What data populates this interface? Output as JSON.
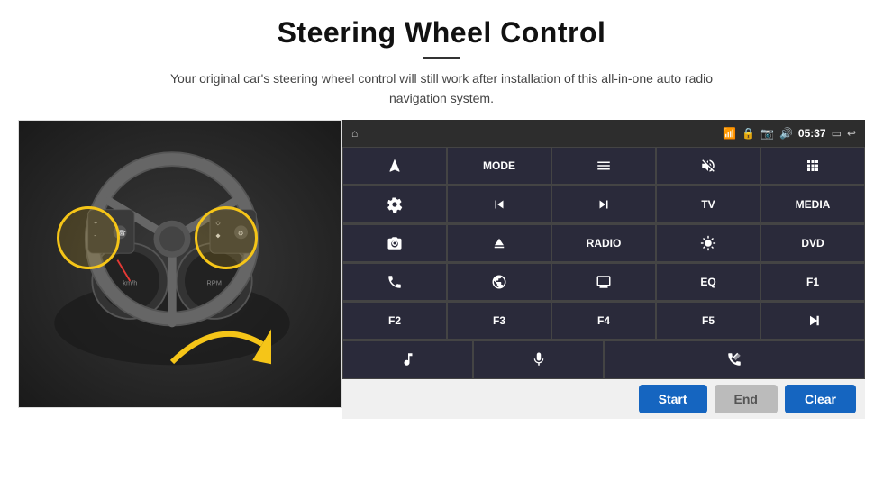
{
  "header": {
    "title": "Steering Wheel Control",
    "description": "Your original car's steering wheel control will still work after installation of this all-in-one auto radio navigation system."
  },
  "status_bar": {
    "time": "05:37",
    "icons": [
      "home",
      "wifi",
      "lock",
      "sd",
      "bluetooth",
      "battery",
      "screen",
      "back"
    ]
  },
  "button_grid": {
    "rows": [
      [
        {
          "type": "icon",
          "icon": "navigate",
          "label": "navigate"
        },
        {
          "type": "text",
          "label": "MODE"
        },
        {
          "type": "icon",
          "icon": "list",
          "label": "list"
        },
        {
          "type": "icon",
          "icon": "mute",
          "label": "mute"
        },
        {
          "type": "icon",
          "icon": "apps",
          "label": "apps"
        }
      ],
      [
        {
          "type": "icon",
          "icon": "settings",
          "label": "settings"
        },
        {
          "type": "icon",
          "icon": "prev",
          "label": "prev"
        },
        {
          "type": "icon",
          "icon": "next",
          "label": "next"
        },
        {
          "type": "text",
          "label": "TV"
        },
        {
          "type": "text",
          "label": "MEDIA"
        }
      ],
      [
        {
          "type": "icon",
          "icon": "360-cam",
          "label": "360"
        },
        {
          "type": "icon",
          "icon": "eject",
          "label": "eject"
        },
        {
          "type": "text",
          "label": "RADIO"
        },
        {
          "type": "icon",
          "icon": "brightness",
          "label": "brightness"
        },
        {
          "type": "text",
          "label": "DVD"
        }
      ],
      [
        {
          "type": "icon",
          "icon": "phone",
          "label": "phone"
        },
        {
          "type": "icon",
          "icon": "browse",
          "label": "browse"
        },
        {
          "type": "icon",
          "icon": "screen-mirror",
          "label": "screen"
        },
        {
          "type": "text",
          "label": "EQ"
        },
        {
          "type": "text",
          "label": "F1"
        }
      ],
      [
        {
          "type": "text",
          "label": "F2"
        },
        {
          "type": "text",
          "label": "F3"
        },
        {
          "type": "text",
          "label": "F4"
        },
        {
          "type": "text",
          "label": "F5"
        },
        {
          "type": "icon",
          "icon": "play-pause",
          "label": "play-pause"
        }
      ],
      [
        {
          "type": "icon",
          "icon": "music",
          "label": "music"
        },
        {
          "type": "icon",
          "icon": "mic",
          "label": "mic"
        },
        {
          "type": "icon",
          "icon": "call-end",
          "label": "call",
          "span": 2
        }
      ]
    ]
  },
  "bottom_buttons": {
    "start": "Start",
    "end": "End",
    "clear": "Clear"
  }
}
